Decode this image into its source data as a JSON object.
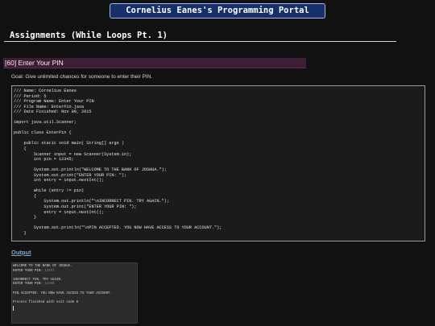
{
  "portal": {
    "title": "Cornelius Eanes's Programming Portal"
  },
  "page": {
    "heading": "Assignments (While Loops Pt. 1)"
  },
  "assignment": {
    "section_title": "[60] Enter Your PIN",
    "goal": "Goal: Give unlimited chances for someone to enter their PIN."
  },
  "code": {
    "lines": [
      "/// Name: Cornelius Eanes",
      "/// Period: 5",
      "/// Program Name: Enter Your PIN",
      "/// File Name: EnterPin.java",
      "/// Date Finished: Nov 09, 2015",
      "",
      "import java.util.Scanner;",
      "",
      "public class EnterPin {",
      "",
      "    public static void main( String[] args )",
      "    {",
      "        Scanner input = new Scanner(System.in);",
      "        int pin = 12345;",
      "",
      "        System.out.println(\"WELCOME TO THE BANK OF JOSHUA.\");",
      "        System.out.print(\"ENTER YOUR PIN: \");",
      "        int entry = input.nextInt();",
      "",
      "        while (entry != pin)",
      "        {",
      "            System.out.println(\"\\nINCORRECT PIN. TRY AGAIN.\");",
      "            System.out.print(\"ENTER YOUR PIN: \");",
      "            entry = input.nextInt();",
      "        }",
      "",
      "        System.out.println(\"\\nPIN ACCEPTED. YOU NOW HAVE ACCESS TO YOUR ACCOUNT.\");",
      "    }",
      "",
      "}"
    ]
  },
  "output": {
    "label": "Output",
    "console": [
      {
        "text": "WELCOME TO THE BANK OF JOSHUA.",
        "input": ""
      },
      {
        "text": "ENTER YOUR PIN: ",
        "input": "12457"
      },
      {
        "text": "",
        "input": ""
      },
      {
        "text": "INCORRECT PIN. TRY AGAIN.",
        "input": ""
      },
      {
        "text": "ENTER YOUR PIN: ",
        "input": "12345"
      },
      {
        "text": "",
        "input": ""
      },
      {
        "text": "PIN ACCEPTED. YOU NOW HAVE ACCESS TO YOUR ACCOUNT.",
        "input": ""
      },
      {
        "text": "",
        "input": ""
      },
      {
        "text": "Process finished with exit code 0",
        "input": ""
      }
    ]
  },
  "colors": {
    "background": "#111111",
    "title_bar": "#16306e",
    "section_bar": "#3e1d37",
    "link": "#80a8d0",
    "console_input": "#5fae5a"
  }
}
